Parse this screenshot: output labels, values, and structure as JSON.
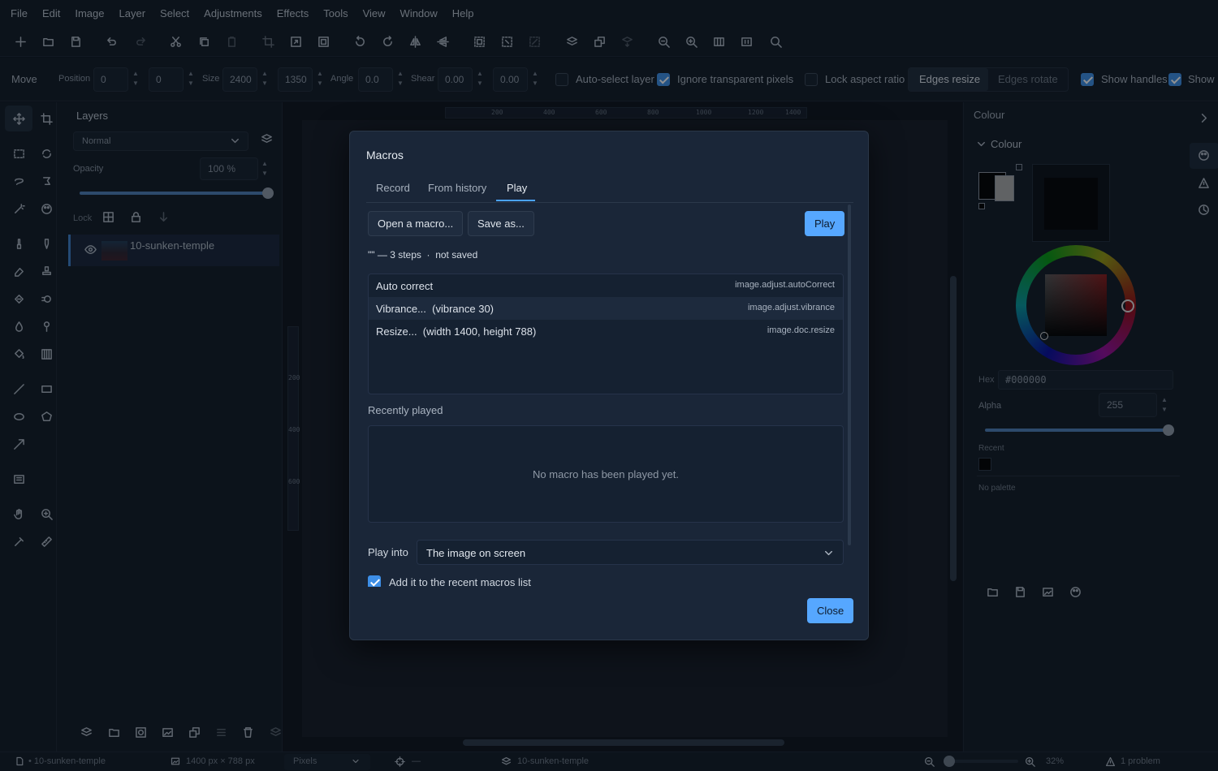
{
  "menu": [
    "File",
    "Edit",
    "Image",
    "Layer",
    "Select",
    "Adjustments",
    "Effects",
    "Tools",
    "View",
    "Window",
    "Help"
  ],
  "options": {
    "tool": "Move",
    "position_label": "Position",
    "pos_x": "0",
    "pos_y": "0",
    "size_label": "Size",
    "width": "2400",
    "height": "1350",
    "angle_label": "Angle",
    "angle": "0.0",
    "shear_label": "Shear",
    "shear_x": "0.00",
    "shear_y": "0.00",
    "auto_select": "Auto-select layer",
    "ignore_transparent": "Ignore transparent pixels",
    "lock_aspect": "Lock aspect ratio",
    "edges_resize": "Edges resize",
    "edges_rotate": "Edges rotate",
    "show_handles": "Show handles",
    "show2": "Show"
  },
  "layers": {
    "title": "Layers",
    "blend": "Normal",
    "opacity_label": "Opacity",
    "opacity": "100 %",
    "opacity_value": 100,
    "lock_label": "Lock",
    "layer_name": "10-sunken-temple"
  },
  "ruler": {
    "h": [
      "200",
      "400",
      "600",
      "800",
      "1000",
      "1200",
      "1400"
    ],
    "v": [
      "200",
      "400",
      "600"
    ]
  },
  "colour": {
    "panel_title": "Colour",
    "section": "Colour",
    "hex_label": "Hex",
    "hex": "#000000",
    "alpha_label": "Alpha",
    "alpha": "255",
    "recent_label": "Recent",
    "no_palette": "No palette"
  },
  "status": {
    "doc": "• 10-sunken-temple",
    "dims": "1400 px × 788 px",
    "units": "Pixels",
    "coords": "—",
    "layer": "10-sunken-temple",
    "zoom": "32%",
    "problems": "1 problem"
  },
  "dialog": {
    "title": "Macros",
    "tabs": [
      "Record",
      "From history",
      "Play"
    ],
    "open": "Open a macro...",
    "save": "Save as...",
    "play": "Play",
    "info": "\"\" — 3 steps  ·  not saved",
    "steps": [
      {
        "name": "Auto correct",
        "id": "image.adjust.autoCorrect"
      },
      {
        "name": "Vibrance...  (vibrance 30)",
        "id": "image.adjust.vibrance"
      },
      {
        "name": "Resize...  (width 1400, height 788)",
        "id": "image.doc.resize"
      }
    ],
    "recently_played": "Recently played",
    "no_macro": "No macro has been played yet.",
    "play_into_label": "Play into",
    "play_into": "The image on screen",
    "add_recent": "Add it to the recent macros list",
    "close": "Close"
  },
  "colors": {
    "accent": "#56a7ff",
    "panel": "#111a26",
    "dialog": "#1a2638"
  }
}
